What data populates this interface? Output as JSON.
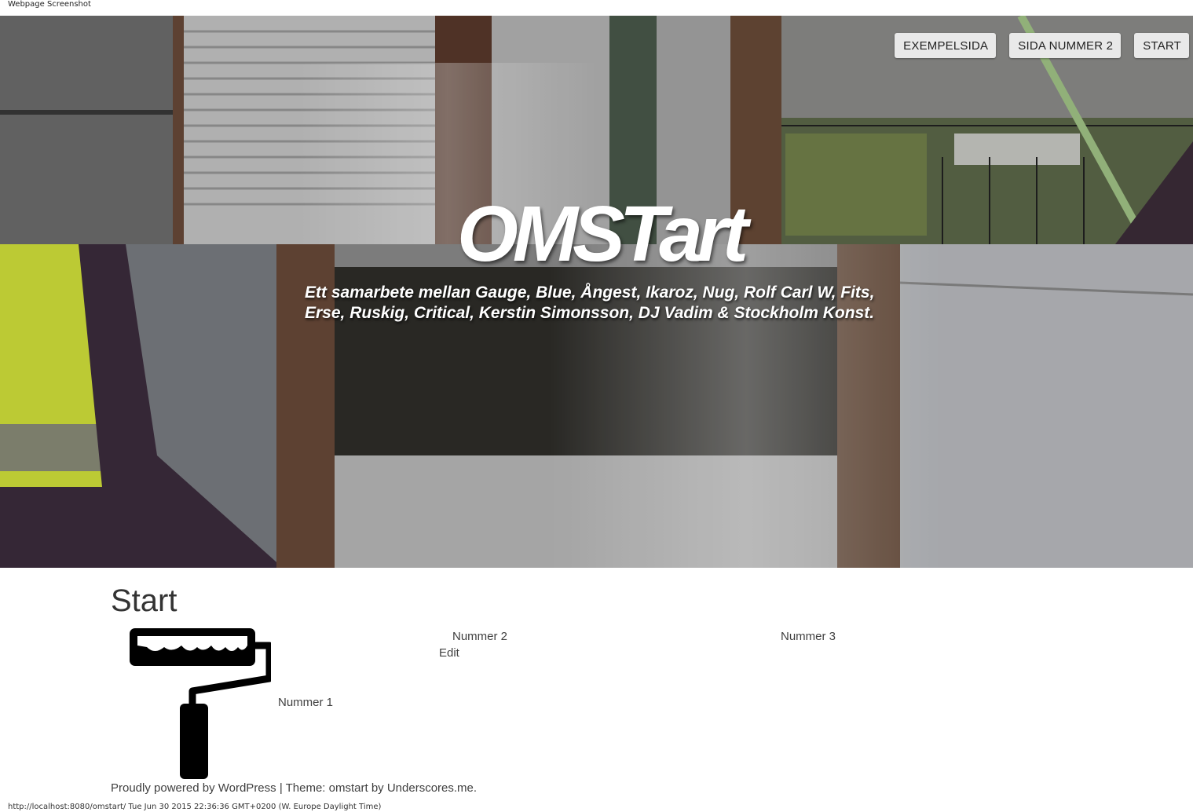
{
  "screenshot_caption": "Webpage Screenshot",
  "nav": {
    "items": [
      {
        "label": "EXEMPELSIDA"
      },
      {
        "label": "SIDA NUMMER 2"
      },
      {
        "label": "START"
      }
    ]
  },
  "header": {
    "title": "OMSTart",
    "description_line1": "Ett samarbete mellan Gauge, Blue, Ångest, Ikaroz, Nug, Rolf Carl W, Fits,",
    "description_line2": "Erse, Ruskig, Critical, Kerstin Simonsson, DJ Vadim & Stockholm Konst."
  },
  "content": {
    "page_title": "Start",
    "items": [
      {
        "label": "Nummer 1"
      },
      {
        "label": "Nummer 2"
      },
      {
        "label": "Nummer 3"
      }
    ],
    "edit_label": "Edit"
  },
  "footer": {
    "powered_text": "Proudly powered by WordPress",
    "separator": " | ",
    "theme_prefix": "Theme: omstart by ",
    "theme_author": "Underscores.me",
    "period": "."
  },
  "status_line": "http://localhost:8080/omstart/ Tue Jun 30 2015 22:36:36 GMT+0200 (W. Europe Daylight Time)"
}
